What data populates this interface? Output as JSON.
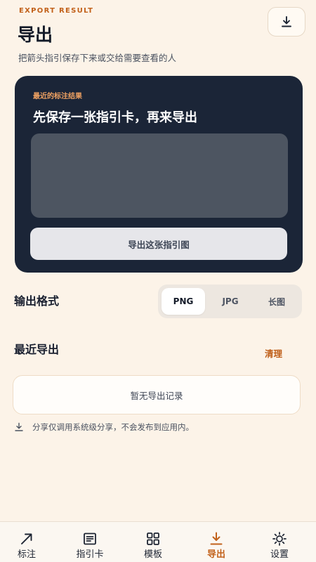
{
  "header": {
    "eyebrow": "EXPORT RESULT",
    "title": "导出",
    "subtitle": "把箭头指引保存下来或交给需要查看的人"
  },
  "result_card": {
    "label": "最近的标注结果",
    "heading": "先保存一张指引卡，再来导出",
    "export_button": "导出这张指引图"
  },
  "format": {
    "label": "输出格式",
    "options": [
      "PNG",
      "JPG",
      "长图"
    ],
    "selected": "PNG"
  },
  "recent": {
    "label": "最近导出",
    "clear": "清理",
    "empty_text": "暂无导出记录"
  },
  "note": "分享仅调用系统级分享，不会发布到应用内。",
  "nav": {
    "items": [
      {
        "label": "标注",
        "icon": "arrow-icon"
      },
      {
        "label": "指引卡",
        "icon": "card-icon"
      },
      {
        "label": "模板",
        "icon": "grid-icon"
      },
      {
        "label": "导出",
        "icon": "download-icon"
      },
      {
        "label": "设置",
        "icon": "gear-icon"
      }
    ],
    "active": "导出"
  },
  "colors": {
    "accent": "#c2611a",
    "background": "#fcf3e8",
    "card": "#1b2537"
  }
}
